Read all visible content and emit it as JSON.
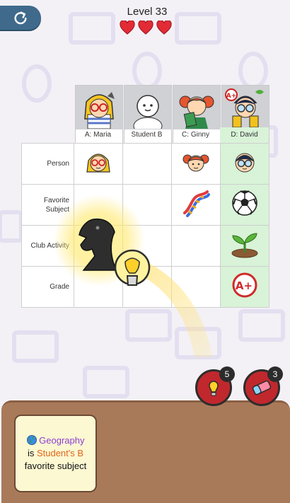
{
  "header": {
    "level_title": "Level 33",
    "hearts": 3,
    "back_icon": "refresh-arrow-icon"
  },
  "characters": [
    {
      "label": "A: Maria"
    },
    {
      "label": "Student B"
    },
    {
      "label": "C: Ginny"
    },
    {
      "label": "D: David",
      "highlight": true
    }
  ],
  "rows": [
    {
      "label": "Person"
    },
    {
      "label": "Favorite Subject"
    },
    {
      "label": "Club Activity"
    },
    {
      "label": "Grade"
    }
  ],
  "cells": {
    "person": {
      "maria": "maria-face-icon",
      "ginny": "ginny-face-icon",
      "david": "david-face-icon"
    },
    "favorite_subject": {
      "ginny": "dna-icon",
      "david": "soccer-ball-icon"
    },
    "club_activity": {
      "david": "sprout-icon"
    },
    "grade": {
      "david": "a-plus-badge-icon"
    }
  },
  "tools": {
    "hint": {
      "icon": "lightbulb-icon",
      "count": "5"
    },
    "eraser": {
      "icon": "eraser-icon",
      "count": "3"
    }
  },
  "clue": {
    "subject": "Geography",
    "connector": "is",
    "student": "Student's B",
    "tail": "favorite subject"
  },
  "colors": {
    "accent_purple": "#8a3fd1",
    "accent_orange": "#e2661b",
    "david_column": "#d8f3d7"
  }
}
